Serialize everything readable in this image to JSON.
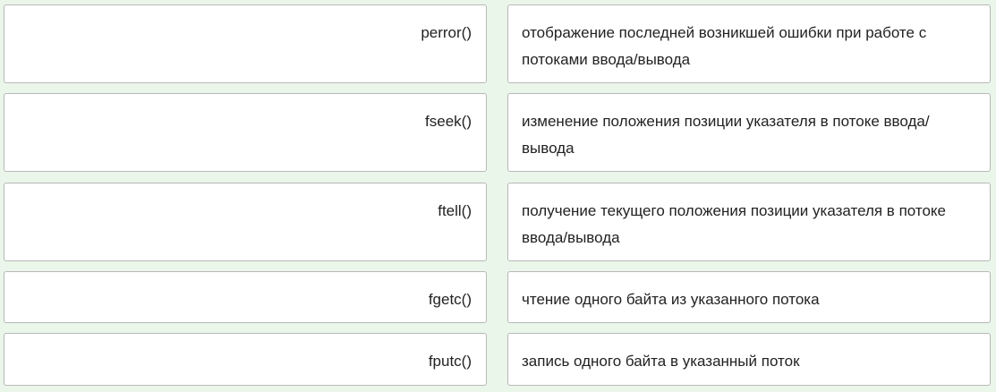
{
  "pairs": [
    {
      "term": "perror()",
      "definition": "отображение последней возникшей ошибки при работе с потоками ввода/вывода"
    },
    {
      "term": "fseek()",
      "definition": "изменение положения позиции указателя в потоке ввода/вывода"
    },
    {
      "term": "ftell()",
      "definition": "получение текущего положения позиции указателя в потоке ввода/вывода"
    },
    {
      "term": "fgetc()",
      "definition": "чтение одного байта из указанного потока"
    },
    {
      "term": "fputc()",
      "definition": "запись одного байта в указанный поток"
    }
  ],
  "colors": {
    "background": "#eaf6ea",
    "card": "#ffffff",
    "border": "#b8b8b8"
  }
}
